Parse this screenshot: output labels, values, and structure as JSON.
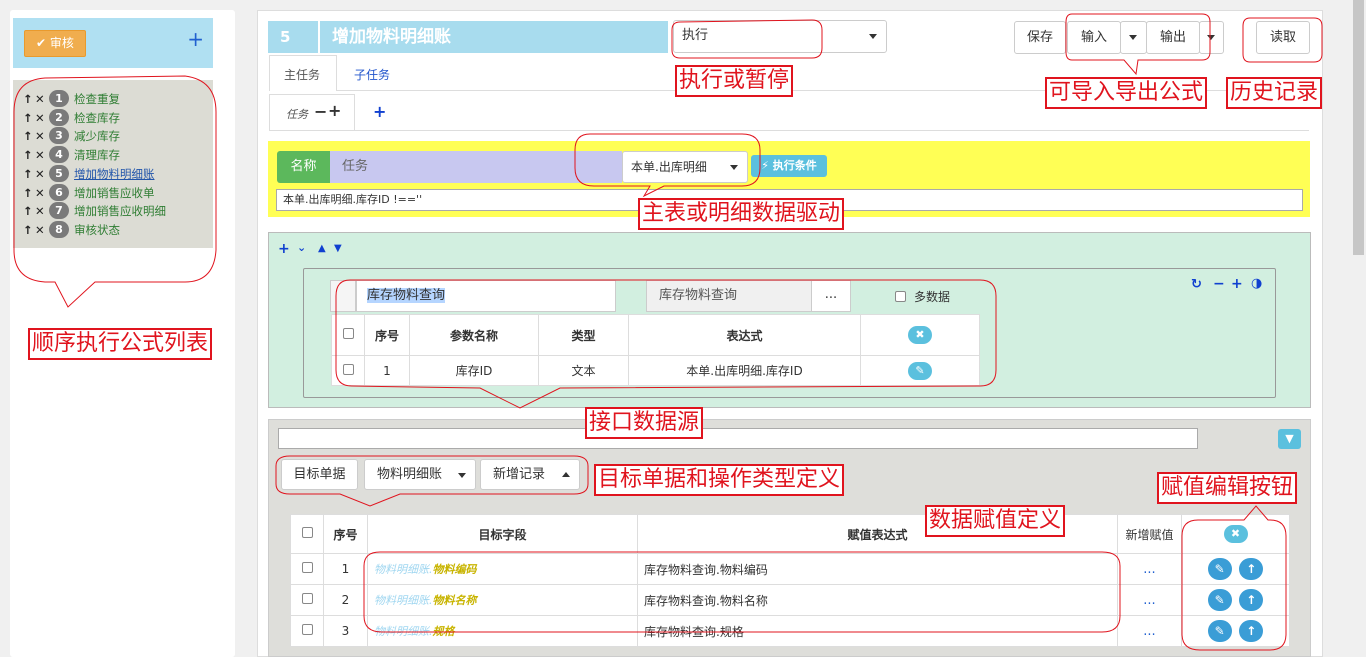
{
  "left": {
    "approve_label": "审核",
    "add_icon": "plus-icon",
    "formulas": [
      {
        "num": "1",
        "label": "检查重复"
      },
      {
        "num": "2",
        "label": "检查库存"
      },
      {
        "num": "3",
        "label": "减少库存"
      },
      {
        "num": "4",
        "label": "清理库存"
      },
      {
        "num": "5",
        "label": "增加物料明细账"
      },
      {
        "num": "6",
        "label": "增加销售应收单"
      },
      {
        "num": "7",
        "label": "增加销售应收明细"
      },
      {
        "num": "8",
        "label": "审核状态"
      }
    ]
  },
  "header": {
    "number": "5",
    "title": "增加物料明细账",
    "mode_select": "执行",
    "save": "保存",
    "input": "输入",
    "output": "输出",
    "read": "读取"
  },
  "tabs": {
    "main": "主任务",
    "sub": "子任务",
    "task": "任务"
  },
  "condition": {
    "name_label": "名称",
    "name_value": "任务",
    "source_select": "本单.出库明细",
    "exec_cond_btn": "执行条件",
    "expression": "本单.出库明细.库存ID !==''"
  },
  "datasource": {
    "query_name": "库存物料查询",
    "query_select": "库存物料查询",
    "more": "...",
    "multi_label": "多数据",
    "columns": [
      "序号",
      "参数名称",
      "类型",
      "表达式"
    ],
    "rows": [
      {
        "idx": "1",
        "name": "库存ID",
        "type": "文本",
        "expr": "本单.出库明细.库存ID"
      }
    ]
  },
  "target": {
    "doc_btn": "目标单据",
    "doc_select": "物料明细账",
    "op_select": "新增记录",
    "columns": [
      "序号",
      "目标字段",
      "赋值表达式",
      "新增赋值"
    ],
    "rows": [
      {
        "idx": "1",
        "prefix": "物料明细账.",
        "field": "物料编码",
        "expr": "库存物料查询.物料编码",
        "more": "..."
      },
      {
        "idx": "2",
        "prefix": "物料明细账.",
        "field": "物料名称",
        "expr": "库存物料查询.物料名称",
        "more": "..."
      },
      {
        "idx": "3",
        "prefix": "物料明细账.",
        "field": "规格",
        "expr": "库存物料查询.规格",
        "more": "..."
      }
    ]
  },
  "annotations": {
    "formula_list": "顺序执行公式列表",
    "exec_pause": "执行或暂停",
    "import_export": "可导入导出公式",
    "history": "历史记录",
    "master_detail": "主表或明细数据驱动",
    "interface_ds": "接口数据源",
    "target_def": "目标单据和操作类型定义",
    "assign_def": "数据赋值定义",
    "assign_btn": "赋值编辑按钮"
  },
  "colors": {
    "accent": "#e0141e",
    "header_bg": "#a8dcee",
    "green": "#5cb85c",
    "info": "#5bc0de"
  }
}
